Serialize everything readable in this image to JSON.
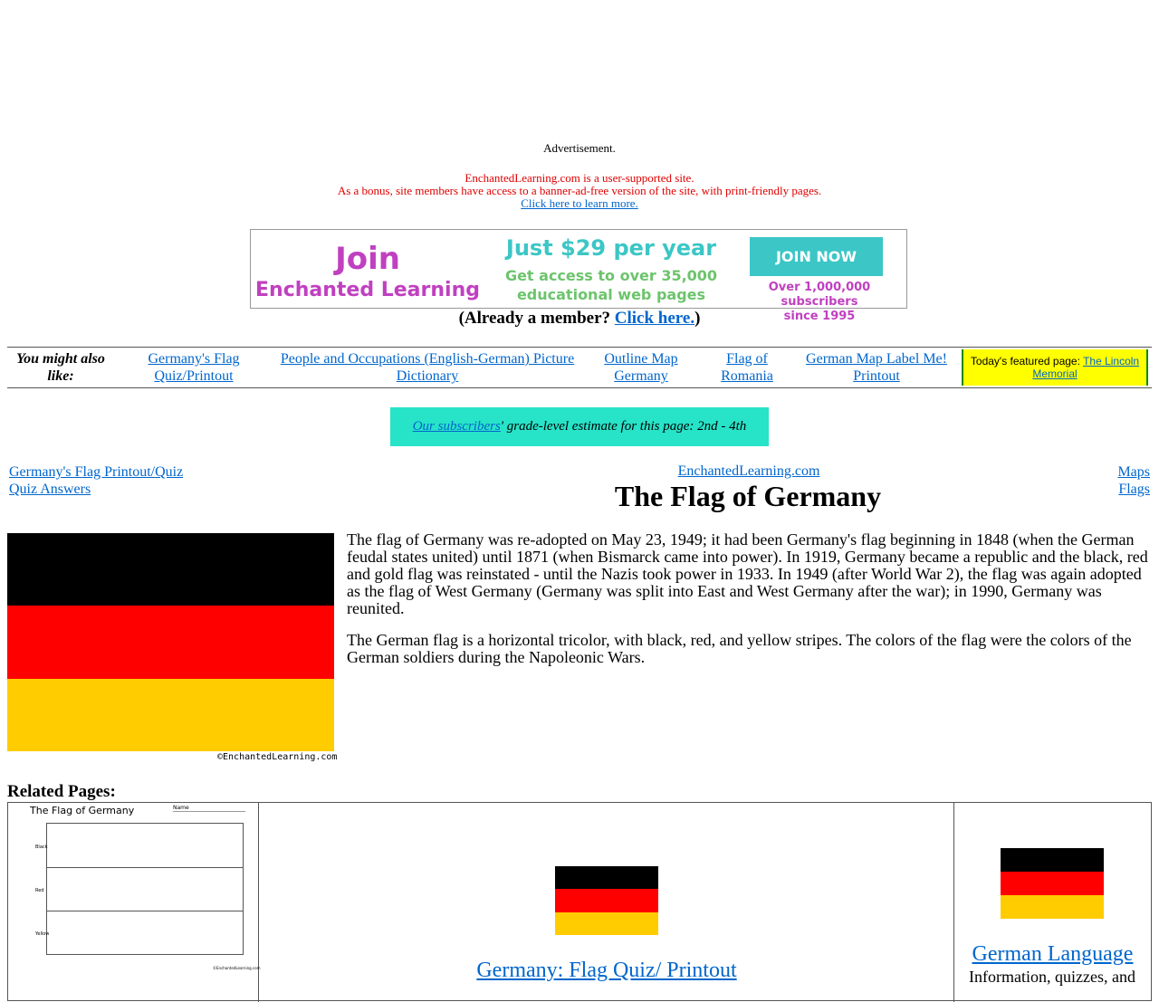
{
  "ad": {
    "label": "Advertisement.",
    "supported_line1": "EnchantedLearning.com is a user-supported site.",
    "supported_line2": "As a bonus, site members have access to a banner-ad-free version of the site, with print-friendly pages.",
    "learn_more": "Click here to learn more."
  },
  "banner": {
    "join": "Join",
    "brand": "Enchanted Learning",
    "price": "Just $29 per year",
    "access_line1": "Get access to over 35,000",
    "access_line2": "educational web pages",
    "button": "JOIN NOW",
    "subs_line1": "Over 1,000,000 subscribers",
    "subs_line2": "since 1995",
    "colors": {
      "magenta": "#c040c0",
      "teal": "#3cc6c6",
      "green": "#6cc46c"
    }
  },
  "member": {
    "prefix": "(Already a member? ",
    "link": "Click here.",
    "suffix": ")"
  },
  "ymal": {
    "lead": "You might also like:",
    "links": [
      "Germany's Flag Quiz/Printout",
      "People and Occupations (English-German) Picture Dictionary",
      "Outline Map Germany",
      "Flag of Romania",
      "German Map Label Me! Printout"
    ],
    "featured_prefix": "Today's featured page: ",
    "featured_link": "The Lincoln Memorial"
  },
  "grade": {
    "link": "Our subscribers",
    "text": "' grade-level estimate for this page: 2nd - 4th"
  },
  "nav": {
    "left": [
      "Germany's Flag Printout/Quiz",
      "Quiz Answers"
    ],
    "right": [
      "Maps",
      "Flags"
    ],
    "site": "EnchantedLearning.com"
  },
  "page": {
    "title": "The Flag of Germany",
    "p1": "The flag of Germany was re-adopted on May 23, 1949; it had been Germany's flag beginning in 1848 (when the German feudal states united) until 1871 (when Bismarck came into power). In 1919, Germany became a republic and the black, red and gold flag was reinstated - until the Nazis took power in 1933. In 1949 (after World War 2), the flag was again adopted as the flag of West Germany (Germany was split into East and West Germany after the war); in 1990, Germany was reunited.",
    "p2": "The German flag is a horizontal tricolor, with black, red, and yellow stripes. The colors of the flag were the colors of the German soldiers during the Napoleonic Wars.",
    "copyright": "©EnchantedLearning.com",
    "flag_colors": [
      "#000000",
      "#ff0000",
      "#ffcc00"
    ]
  },
  "related": {
    "heading": "Related Pages:",
    "worksheet": {
      "title": "The Flag of Germany",
      "name_label": "Name",
      "stripe_labels": [
        "Black",
        "Red",
        "Yellow"
      ],
      "copyright": "©EnchantedLearning.com"
    },
    "center_link": "Germany: Flag Quiz/ Printout",
    "right_link": "German Language",
    "right_desc": "Information, quizzes, and"
  }
}
